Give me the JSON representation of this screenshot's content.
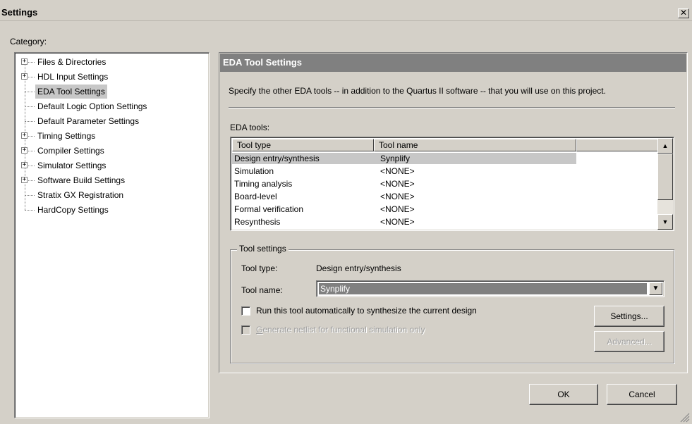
{
  "window": {
    "title": "Settings",
    "close_glyph": "✕"
  },
  "category": {
    "label": "Category:",
    "items": [
      {
        "label": "Files & Directories",
        "expandable": true
      },
      {
        "label": "HDL Input Settings",
        "expandable": true
      },
      {
        "label": "EDA Tool Settings",
        "expandable": false,
        "selected": true
      },
      {
        "label": "Default Logic Option Settings",
        "expandable": false
      },
      {
        "label": "Default Parameter Settings",
        "expandable": false
      },
      {
        "label": "Timing Settings",
        "expandable": true
      },
      {
        "label": "Compiler Settings",
        "expandable": true
      },
      {
        "label": "Simulator Settings",
        "expandable": true
      },
      {
        "label": "Software Build Settings",
        "expandable": true
      },
      {
        "label": "Stratix GX Registration",
        "expandable": false
      },
      {
        "label": "HardCopy Settings",
        "expandable": false
      }
    ]
  },
  "panel": {
    "header": "EDA Tool Settings",
    "description": "Specify the other EDA tools -- in addition to the Quartus II software -- that you will use on this project.",
    "eda_tools_label": "EDA tools:",
    "columns": [
      "Tool type",
      "Tool name"
    ],
    "rows": [
      {
        "type": "Design entry/synthesis",
        "name": "Synplify",
        "selected": true
      },
      {
        "type": "Simulation",
        "name": "<NONE>"
      },
      {
        "type": "Timing analysis",
        "name": "<NONE>"
      },
      {
        "type": "Board-level",
        "name": "<NONE>"
      },
      {
        "type": "Formal verification",
        "name": "<NONE>"
      },
      {
        "type": "Resynthesis",
        "name": "<NONE>"
      }
    ],
    "tool_settings": {
      "legend": "Tool settings",
      "tool_type_label": "Tool type:",
      "tool_type_value": "Design entry/synthesis",
      "tool_name_label": "Tool name:",
      "tool_name_value": "Synplify",
      "run_auto_label": "Run this tool automatically to synthesize the current design",
      "run_auto_checked": false,
      "netlist_label": "Generate netlist for functional simulation only",
      "netlist_checked": false,
      "netlist_enabled": false,
      "settings_button": "Settings...",
      "advanced_button": "Advanced..."
    }
  },
  "footer": {
    "ok": "OK",
    "cancel": "Cancel"
  }
}
